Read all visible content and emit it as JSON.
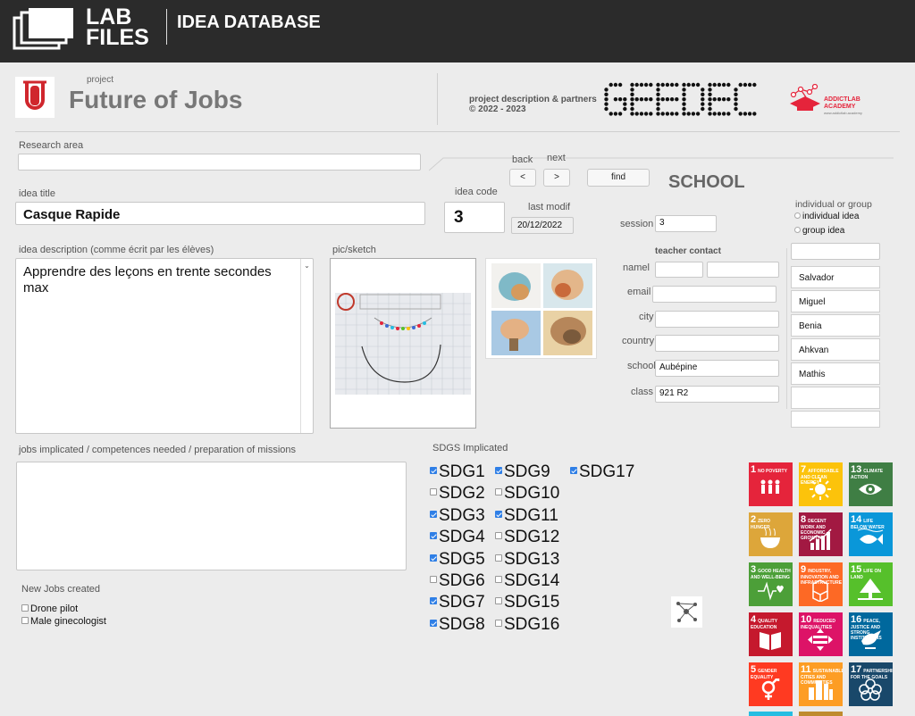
{
  "header": {
    "logo_line1": "LAB",
    "logo_line2": "FILES",
    "title": "IDEA DATABASE"
  },
  "project": {
    "label": "project",
    "name": "Future of Jobs",
    "description_line1": "project description & partners",
    "description_line2": "© 2022 - 2023",
    "partner_logo_text": "GEEDEC",
    "academy_line1": "ADDICTLAB",
    "academy_line2": "ACADEMY",
    "academy_url": "www.addictlab.academy"
  },
  "research": {
    "label": "Research area",
    "value": ""
  },
  "nav": {
    "back_label": "back",
    "next_label": "next",
    "back_button": "<",
    "next_button": ">",
    "find_button": "find"
  },
  "school_heading": "SCHOOL",
  "idea": {
    "title_label": "idea title",
    "title_value": "Casque Rapide",
    "code_label": "idea code",
    "code_value": "3",
    "last_modif_label": "last modif",
    "last_modif_value": "20/12/2022",
    "description_label": "idea description (comme écrit par les élèves)",
    "description_value": "Apprendre des leçons en trente secondes max",
    "sketch_label": "pic/sketch"
  },
  "session": {
    "label": "session",
    "value": "3"
  },
  "teacher": {
    "heading": "teacher contact",
    "name_label": "namel",
    "email_label": "email",
    "city_label": "city",
    "country_label": "country",
    "school_label": "school",
    "school_value": "Aubépine",
    "class_label": "class",
    "class_value": "921 R2"
  },
  "group": {
    "label": "individual or group",
    "option_individual": "individual idea",
    "option_group": "group idea",
    "students": [
      "",
      "Salvador",
      "Miguel",
      "Benia",
      "Ahkvan",
      "Mathis",
      "",
      ""
    ]
  },
  "jobs": {
    "label": "jobs implicated / competences needed / preparation of missions",
    "value": "",
    "new_jobs_label": "New Jobs created",
    "new_jobs": [
      {
        "label": "Drone pilot",
        "checked": false
      },
      {
        "label": "Male ginecologist",
        "checked": false
      }
    ]
  },
  "sdgs": {
    "label": "SDGS Implicated",
    "col1": [
      {
        "label": "SDG1",
        "checked": true
      },
      {
        "label": "SDG2",
        "checked": false
      },
      {
        "label": "SDG3",
        "checked": true
      },
      {
        "label": "SDG4",
        "checked": true
      },
      {
        "label": "SDG5",
        "checked": true
      },
      {
        "label": "SDG6",
        "checked": false
      },
      {
        "label": "SDG7",
        "checked": true
      },
      {
        "label": "SDG8",
        "checked": true
      }
    ],
    "col2": [
      {
        "label": "SDG9",
        "checked": true
      },
      {
        "label": "SDG10",
        "checked": false
      },
      {
        "label": "SDG11",
        "checked": true
      },
      {
        "label": "SDG12",
        "checked": false
      },
      {
        "label": "SDG13",
        "checked": false
      },
      {
        "label": "SDG14",
        "checked": false
      },
      {
        "label": "SDG15",
        "checked": false
      },
      {
        "label": "SDG16",
        "checked": false
      }
    ],
    "col3": [
      {
        "label": "SDG17",
        "checked": true
      }
    ]
  },
  "sdg_tiles": [
    {
      "num": "1",
      "text": "NO POVERTY",
      "color": "#e5243b",
      "icon": "people-icon"
    },
    {
      "num": "7",
      "text": "AFFORDABLE AND CLEAN ENERGY",
      "color": "#fcc30b",
      "icon": "sun-icon"
    },
    {
      "num": "13",
      "text": "CLIMATE ACTION",
      "color": "#3f7e44",
      "icon": "eye-icon"
    },
    {
      "num": "2",
      "text": "ZERO HUNGER",
      "color": "#dda63a",
      "icon": "bowl-icon"
    },
    {
      "num": "8",
      "text": "DECENT WORK AND ECONOMIC GROWTH",
      "color": "#a21942",
      "icon": "growth-chart-icon"
    },
    {
      "num": "14",
      "text": "LIFE BELOW WATER",
      "color": "#0a97d9",
      "icon": "fish-icon"
    },
    {
      "num": "3",
      "text": "GOOD HEALTH AND WELL-BEING",
      "color": "#4c9f38",
      "icon": "heartbeat-icon"
    },
    {
      "num": "9",
      "text": "INDUSTRY, INNOVATION AND INFRASTRUCTURE",
      "color": "#fd6925",
      "icon": "cubes-icon"
    },
    {
      "num": "15",
      "text": "LIFE ON LAND",
      "color": "#56c02b",
      "icon": "tree-icon"
    },
    {
      "num": "4",
      "text": "QUALITY EDUCATION",
      "color": "#c5192d",
      "icon": "book-icon"
    },
    {
      "num": "10",
      "text": "REDUCED INEQUALITIES",
      "color": "#dd1367",
      "icon": "equality-icon"
    },
    {
      "num": "16",
      "text": "PEACE, JUSTICE AND STRONG INSTITUTIONS",
      "color": "#00689d",
      "icon": "dove-icon"
    },
    {
      "num": "5",
      "text": "GENDER EQUALITY",
      "color": "#ff3a21",
      "icon": "gender-icon"
    },
    {
      "num": "11",
      "text": "SUSTAINABLE CITIES AND COMMUNITIES",
      "color": "#fd9d24",
      "icon": "city-icon"
    },
    {
      "num": "17",
      "text": "PARTNERSHIPS FOR THE GOALS",
      "color": "#19486a",
      "icon": "rings-icon"
    }
  ]
}
